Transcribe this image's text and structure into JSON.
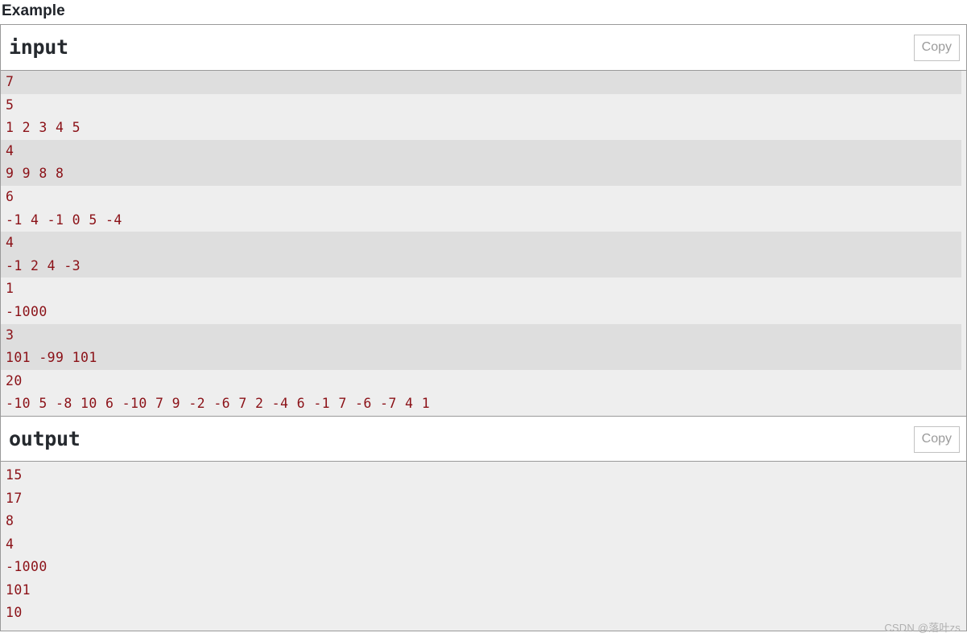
{
  "page": {
    "heading": "Example",
    "watermark": "CSDN @落叶zs",
    "accent_text_color": "#8b1117",
    "stripe_dark": "#dedede",
    "stripe_light": "#eeeeee",
    "border_color": "#9a9a9a"
  },
  "input_block": {
    "title": "input",
    "copy_label": "Copy",
    "lines": [
      {
        "text": "7",
        "shaded": true
      },
      {
        "text": "5",
        "shaded": false
      },
      {
        "text": "1 2 3 4 5",
        "shaded": false
      },
      {
        "text": "4",
        "shaded": true
      },
      {
        "text": "9 9 8 8",
        "shaded": true
      },
      {
        "text": "6",
        "shaded": false
      },
      {
        "text": "-1 4 -1 0 5 -4",
        "shaded": false
      },
      {
        "text": "4",
        "shaded": true
      },
      {
        "text": "-1 2 4 -3",
        "shaded": true
      },
      {
        "text": "1",
        "shaded": false
      },
      {
        "text": "-1000",
        "shaded": false
      },
      {
        "text": "3",
        "shaded": true
      },
      {
        "text": "101 -99 101",
        "shaded": true
      },
      {
        "text": "20",
        "shaded": false
      },
      {
        "text": "-10 5 -8 10 6 -10 7 9 -2 -6 7 2 -4 6 -1 7 -6 -7 4 1",
        "shaded": false
      }
    ]
  },
  "output_block": {
    "title": "output",
    "copy_label": "Copy",
    "lines": [
      {
        "text": "15",
        "shaded": false
      },
      {
        "text": "17",
        "shaded": false
      },
      {
        "text": "8",
        "shaded": false
      },
      {
        "text": "4",
        "shaded": false
      },
      {
        "text": "-1000",
        "shaded": false
      },
      {
        "text": "101",
        "shaded": false
      },
      {
        "text": "10",
        "shaded": false
      }
    ]
  }
}
